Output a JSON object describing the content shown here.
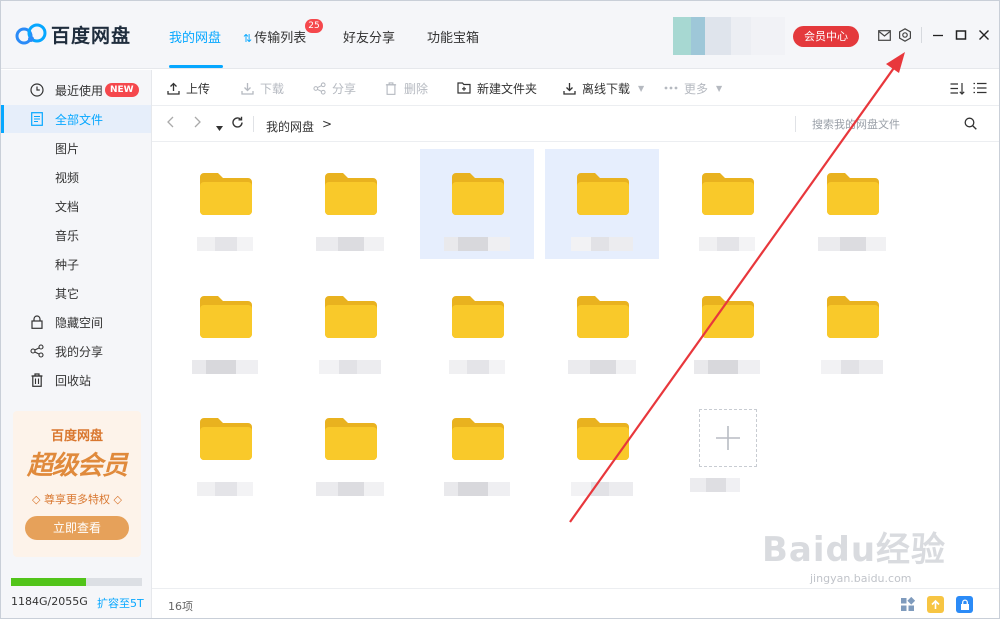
{
  "app": {
    "name": "百度网盘"
  },
  "nav": {
    "tabs": [
      {
        "label": "我的网盘"
      },
      {
        "label": "传输列表",
        "badge": "25"
      },
      {
        "label": "好友分享"
      },
      {
        "label": "功能宝箱"
      }
    ],
    "vip_label": "会员中心"
  },
  "sidebar": {
    "items": [
      {
        "label": "最近使用",
        "icon": "clock-icon",
        "badge": "NEW"
      },
      {
        "label": "全部文件",
        "icon": "document-icon"
      },
      {
        "label": "图片"
      },
      {
        "label": "视频"
      },
      {
        "label": "文档"
      },
      {
        "label": "音乐"
      },
      {
        "label": "种子"
      },
      {
        "label": "其它"
      },
      {
        "label": "隐藏空间",
        "icon": "lock-icon"
      },
      {
        "label": "我的分享",
        "icon": "share-icon"
      },
      {
        "label": "回收站",
        "icon": "trash-icon"
      }
    ],
    "promo": {
      "title": "百度网盘",
      "headline": "超级会员",
      "tagline": "◇ 尊享更多特权 ◇",
      "button": "立即查看"
    },
    "storage": {
      "used_text": "1184G/2055G",
      "used_fraction": 0.576,
      "upgrade_link": "扩容至5T"
    }
  },
  "toolbar": {
    "upload": "上传",
    "download": "下载",
    "share": "分享",
    "delete": "删除",
    "new_folder": "新建文件夹",
    "offline_download": "离线下载",
    "more": "更多"
  },
  "address": {
    "breadcrumb": "我的网盘",
    "breadcrumb_sep": ">",
    "search_placeholder": "搜索我的网盘文件"
  },
  "files": {
    "count": 16
  },
  "status": {
    "count_text": "16项"
  },
  "colors": {
    "accent": "#06a7ff",
    "folder": "#f9c92a",
    "vip": "#e4393c",
    "annotation": "#e8373c"
  },
  "watermark": {
    "text": "Baidu经验",
    "sub": "jingyan.baidu.com"
  }
}
